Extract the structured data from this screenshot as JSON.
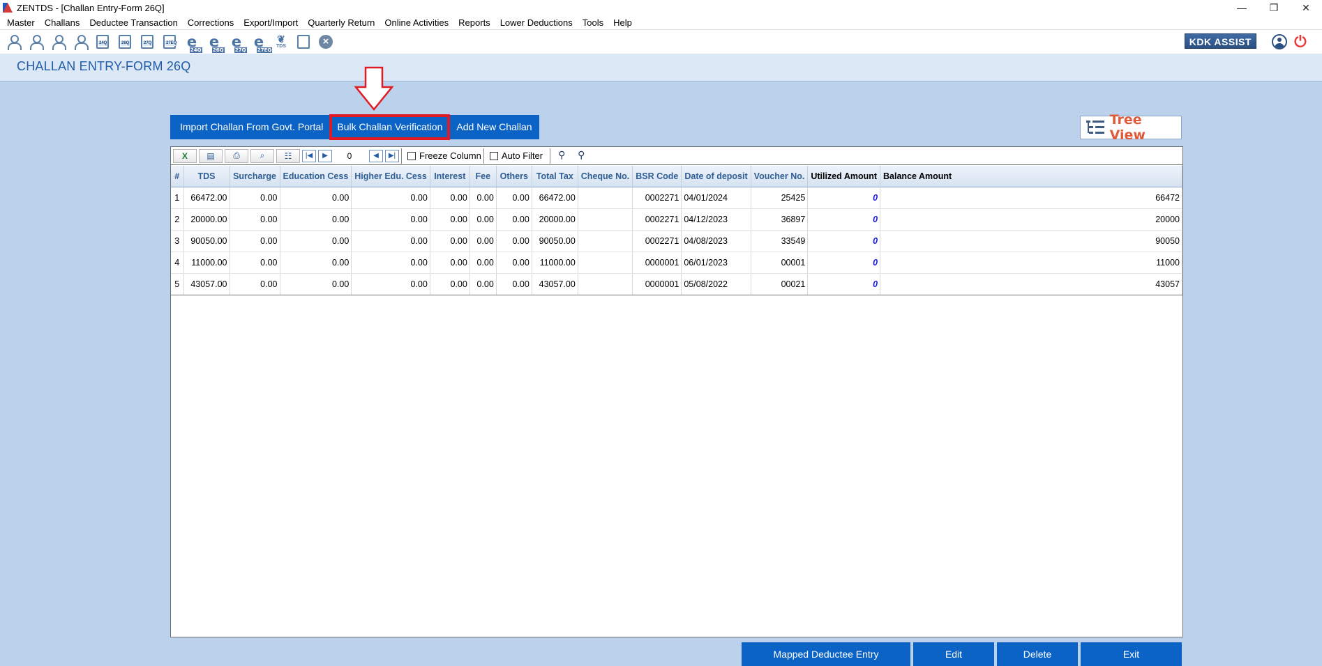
{
  "window": {
    "title": "ZENTDS - [Challan Entry-Form 26Q]",
    "minimize": "—",
    "restore": "❐",
    "close": "✕"
  },
  "menu": [
    "Master",
    "Challans",
    "Deductee Transaction",
    "Corrections",
    "Export/Import",
    "Quarterly Return",
    "Online Activities",
    "Reports",
    "Lower Deductions",
    "Tools",
    "Help"
  ],
  "toolbar": {
    "kdk_assist": "KDK ASSIST",
    "doc_tags": [
      "24Q",
      "26Q",
      "27Q",
      "27EQ"
    ],
    "e_tags": [
      "24Q",
      "26Q",
      "27Q",
      "27EQ"
    ],
    "tds_label": "TDS"
  },
  "page": {
    "title": "CHALLAN ENTRY-FORM 26Q"
  },
  "actions": {
    "import": "Import Challan From Govt. Portal",
    "bulk_verify": "Bulk Challan Verification",
    "add_new": "Add New Challan",
    "tree_view": "Tree View"
  },
  "grid_toolbar": {
    "page_number": "0",
    "freeze_column": "Freeze Column",
    "auto_filter": "Auto Filter"
  },
  "table": {
    "columns": [
      "#",
      "TDS",
      "Surcharge",
      "Education Cess",
      "Higher Edu. Cess",
      "Interest",
      "Fee",
      "Others",
      "Total Tax",
      "Cheque No.",
      "BSR Code",
      "Date of deposit",
      "Voucher No.",
      "Utilized Amount",
      "Balance Amount"
    ],
    "rows": [
      [
        "1",
        "66472.00",
        "0.00",
        "0.00",
        "0.00",
        "0.00",
        "0.00",
        "0.00",
        "66472.00",
        "",
        "0002271",
        "04/01/2024",
        "25425",
        "0",
        "66472"
      ],
      [
        "2",
        "20000.00",
        "0.00",
        "0.00",
        "0.00",
        "0.00",
        "0.00",
        "0.00",
        "20000.00",
        "",
        "0002271",
        "04/12/2023",
        "36897",
        "0",
        "20000"
      ],
      [
        "3",
        "90050.00",
        "0.00",
        "0.00",
        "0.00",
        "0.00",
        "0.00",
        "0.00",
        "90050.00",
        "",
        "0002271",
        "04/08/2023",
        "33549",
        "0",
        "90050"
      ],
      [
        "4",
        "11000.00",
        "0.00",
        "0.00",
        "0.00",
        "0.00",
        "0.00",
        "0.00",
        "11000.00",
        "",
        "0000001",
        "06/01/2023",
        "00001",
        "0",
        "11000"
      ],
      [
        "5",
        "43057.00",
        "0.00",
        "0.00",
        "0.00",
        "0.00",
        "0.00",
        "0.00",
        "43057.00",
        "",
        "0000001",
        "05/08/2022",
        "00021",
        "0",
        "43057"
      ]
    ]
  },
  "bottom": {
    "mapped": "Mapped Deductee Entry",
    "edit": "Edit",
    "delete": "Delete",
    "exit": "Exit"
  },
  "colors": {
    "accent": "#0b63c5",
    "highlight": "#e01b24",
    "background": "#bcd2ec"
  }
}
